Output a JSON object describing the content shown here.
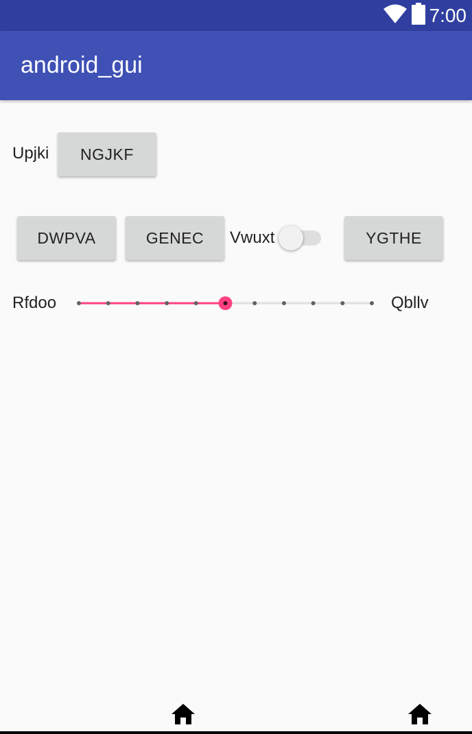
{
  "status_bar": {
    "time": "7:00",
    "icons": [
      "wifi-icon",
      "battery-icon"
    ]
  },
  "app_bar": {
    "title": "android_gui",
    "color": "#3f51b5",
    "status_color": "#303f9f"
  },
  "row1": {
    "label": "Upjki",
    "button": "NGJKF"
  },
  "row2": {
    "button1": "DWPVA",
    "button2": "GENEC",
    "switch_label": "Vwuxt",
    "switch_on": false,
    "button3": "YGTHE"
  },
  "seekbar": {
    "left_label": "Rfdoo",
    "right_label": "Qbllv",
    "max": 10,
    "value": 5,
    "accent_color": "#ff4081"
  },
  "nav_bar": {
    "icons": [
      "home-icon",
      "home-icon"
    ]
  }
}
